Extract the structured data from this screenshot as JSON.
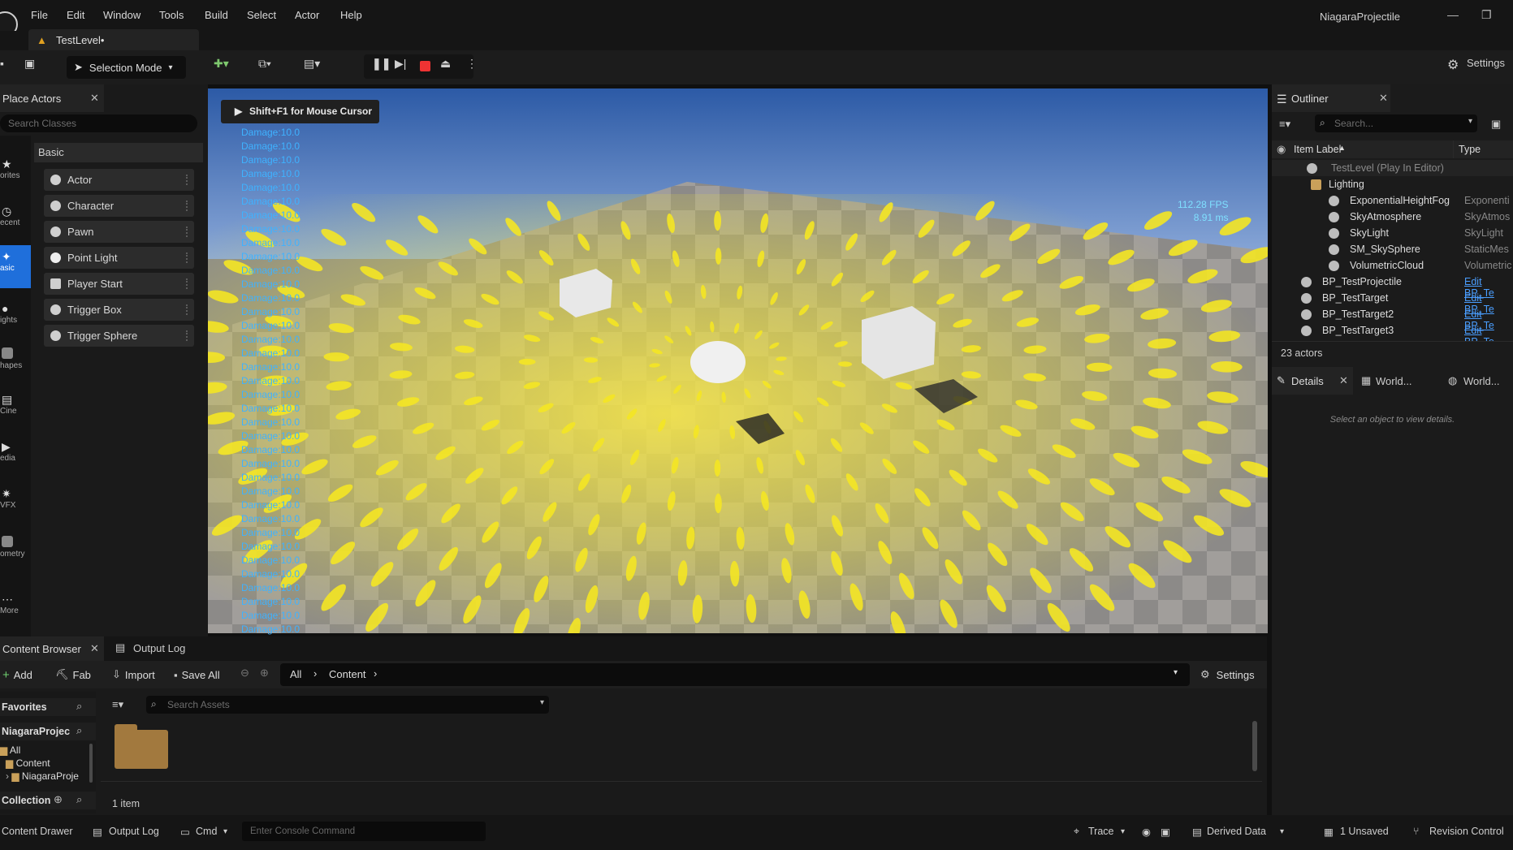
{
  "menu": {
    "items": [
      "File",
      "Edit",
      "Window",
      "Tools",
      "Build",
      "Select",
      "Actor",
      "Help"
    ],
    "project_name": "NiagaraProjectile"
  },
  "level_tab": {
    "label": "TestLevel•"
  },
  "toolbar": {
    "selection_mode": "Selection Mode",
    "settings_label": "Settings"
  },
  "place_actors": {
    "tab_label": "Place Actors",
    "search_placeholder": "Search Classes",
    "categories": [
      "orites",
      "ecent",
      "asic",
      "ights",
      "hapes",
      "Cine",
      "edia",
      "VFX",
      "ometry",
      "More"
    ],
    "section_label": "Basic",
    "items": [
      "Actor",
      "Character",
      "Pawn",
      "Point Light",
      "Player Start",
      "Trigger Box",
      "Trigger Sphere"
    ]
  },
  "viewport": {
    "hint": "Shift+F1 for Mouse Cursor",
    "damage_text": "Damage:10.0",
    "damage_count": 37,
    "fps": "112.28 FPS",
    "ms": "8.91 ms"
  },
  "outliner": {
    "tab_label": "Outliner",
    "search_placeholder": "Search...",
    "col_label": "Item Label",
    "col_type": "Type",
    "rows": [
      {
        "label": "TestLevel (Play In Editor)",
        "type": ""
      },
      {
        "label": "Lighting",
        "type": ""
      },
      {
        "label": "ExponentialHeightFog",
        "type": "Exponenti"
      },
      {
        "label": "SkyAtmosphere",
        "type": "SkyAtmos"
      },
      {
        "label": "SkyLight",
        "type": "SkyLight"
      },
      {
        "label": "SM_SkySphere",
        "type": "StaticMes"
      },
      {
        "label": "VolumetricCloud",
        "type": "Volumetric"
      },
      {
        "label": "BP_TestProjectile",
        "type": "Edit BP_Te"
      },
      {
        "label": "BP_TestTarget",
        "type": "Edit BP_Te"
      },
      {
        "label": "BP_TestTarget2",
        "type": "Edit BP_Te"
      },
      {
        "label": "BP_TestTarget3",
        "type": "Edit BP_Te"
      }
    ],
    "actor_count": "23 actors"
  },
  "details": {
    "tabs": [
      "Details",
      "World...",
      "World..."
    ],
    "empty_message": "Select an object to view details."
  },
  "content_browser": {
    "tabs": [
      "Content Browser",
      "Output Log"
    ],
    "add": "Add",
    "fab": "Fab",
    "import": "Import",
    "save_all": "Save All",
    "path": [
      "All",
      "Content"
    ],
    "settings": "Settings",
    "search_placeholder": "Search Assets",
    "favorites": "Favorites",
    "project": "NiagaraProjec",
    "tree": [
      "All",
      "Content",
      "NiagaraProje"
    ],
    "collection": "Collection",
    "item_count": "1 item"
  },
  "statusbar": {
    "content_drawer": "Content Drawer",
    "output_log": "Output Log",
    "cmd": "Cmd",
    "console_placeholder": "Enter Console Command",
    "trace": "Trace",
    "derived_data": "Derived Data",
    "unsaved": "1 Unsaved",
    "revision_control": "Revision Control"
  }
}
